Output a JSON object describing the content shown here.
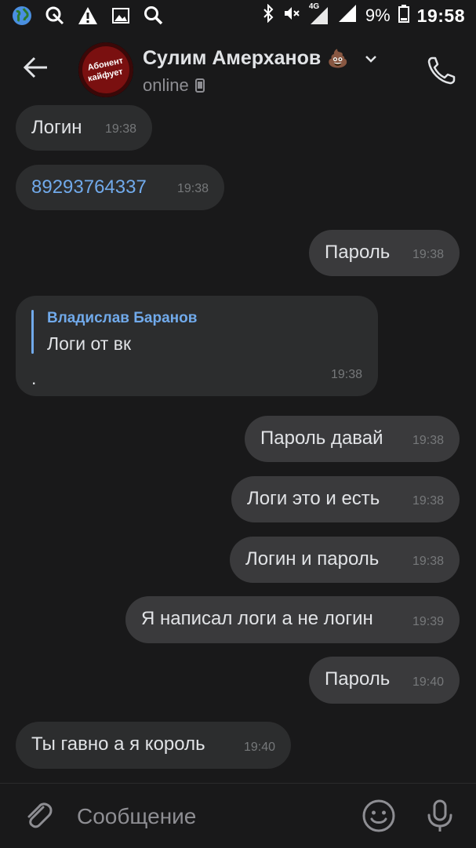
{
  "status_bar": {
    "network": "4G",
    "battery": "9%",
    "time": "19:58"
  },
  "header": {
    "contact_name": "Сулим Амерханов",
    "name_emoji": "💩",
    "presence": "online",
    "avatar_text_line1": "Абонент",
    "avatar_text_line2": "кайфует"
  },
  "messages": [
    {
      "text": "Логин",
      "time": "19:38",
      "direction": "in"
    },
    {
      "text": "89293764337",
      "time": "19:38",
      "direction": "in",
      "is_link": true
    },
    {
      "text": "Пароль",
      "time": "19:38",
      "direction": "out"
    },
    {
      "reply_to_name": "Владислав Баранов",
      "reply_to_text": "Логи от вк",
      "text": ".",
      "time": "19:38",
      "direction": "in"
    },
    {
      "text": "Пароль давай",
      "time": "19:38",
      "direction": "out"
    },
    {
      "text": "Логи это и есть",
      "time": "19:38",
      "direction": "out"
    },
    {
      "text": "Логин и пароль",
      "time": "19:38",
      "direction": "out"
    },
    {
      "text": "Я написал логи а не логин",
      "time": "19:39",
      "direction": "out"
    },
    {
      "text": "Пароль",
      "time": "19:40",
      "direction": "out"
    },
    {
      "text": "Ты гавно а я король",
      "time": "19:40",
      "direction": "in"
    }
  ],
  "composer": {
    "placeholder": "Сообщение",
    "value": ""
  },
  "colors": {
    "background": "#19191a",
    "incoming_bubble": "#2c2d2e",
    "outgoing_bubble": "#3a3a3c",
    "accent_link": "#71aaeb"
  }
}
